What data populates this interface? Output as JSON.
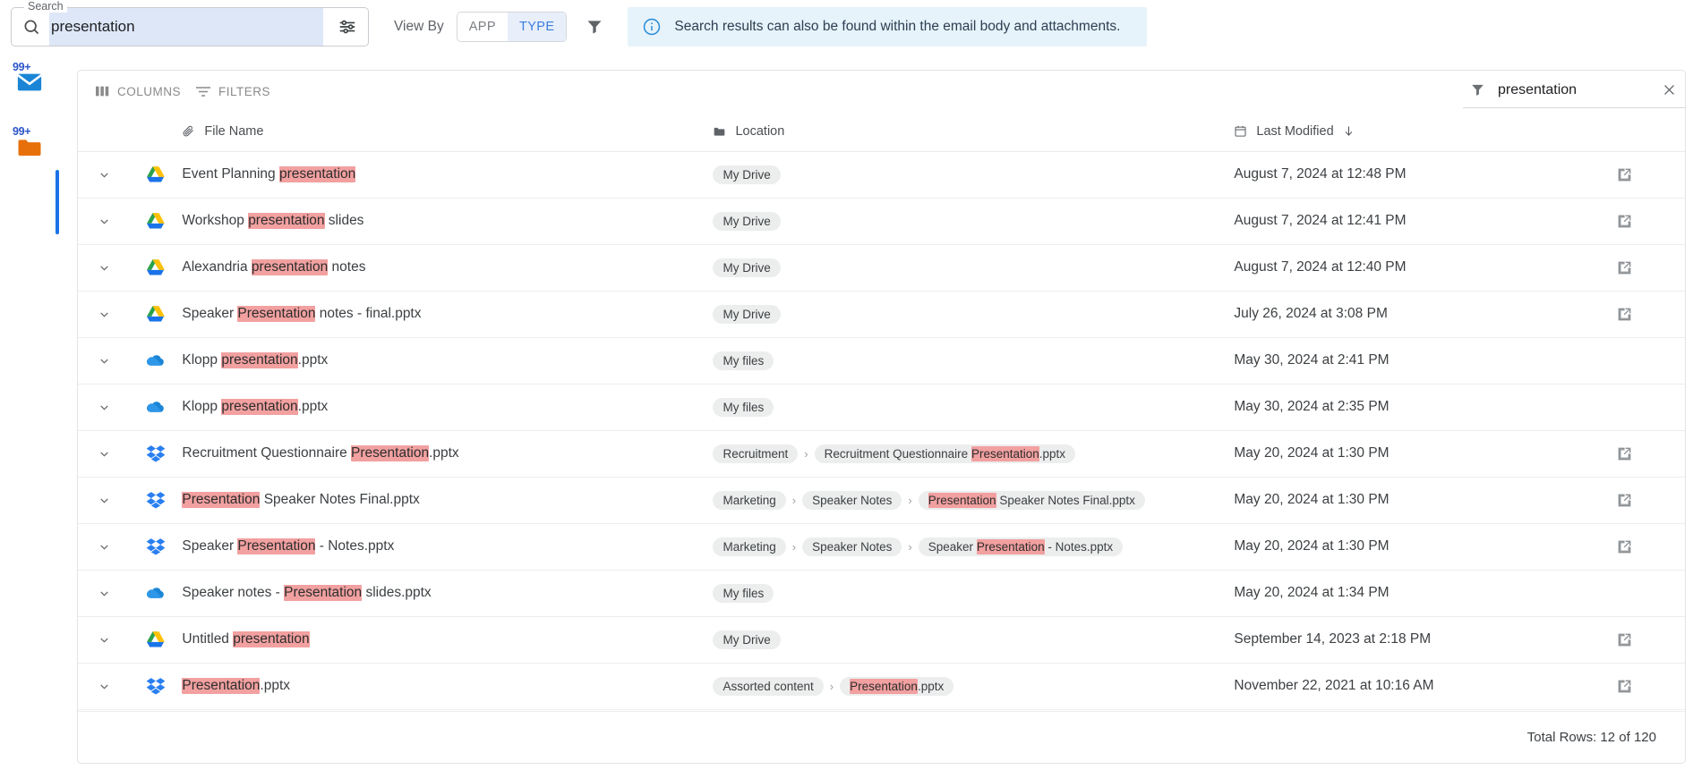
{
  "topbar": {
    "search": {
      "legend": "Search",
      "value": "presentation",
      "placeholder": "Search",
      "icon": "search-icon",
      "tune_icon": "tune-icon"
    },
    "view_by_label": "View By",
    "toggles": [
      {
        "label": "APP",
        "active": false
      },
      {
        "label": "TYPE",
        "active": true
      }
    ],
    "funnel_icon": "filter-funnel-icon",
    "info_banner": {
      "icon": "info-circle-icon",
      "text": "Search results can also be found within the email body and attachments.",
      "background": "#e6f3fb"
    }
  },
  "rail": {
    "items": [
      {
        "name": "mail",
        "badge": "99+",
        "color": "#1a85d6"
      },
      {
        "name": "folder",
        "badge": "99+",
        "color": "#e8700a"
      }
    ],
    "accent_color": "#1a73e8"
  },
  "panel": {
    "toolbar": {
      "columns_label": "COLUMNS",
      "columns_icon": "columns-icon",
      "filters_label": "FILTERS",
      "filters_icon": "filters-icon"
    },
    "filter_chip": {
      "icon": "funnel-icon",
      "value": "presentation",
      "close_icon": "close-icon"
    },
    "columns": [
      {
        "key": "file_name",
        "label": "File Name",
        "icon": "paperclip-icon"
      },
      {
        "key": "location",
        "label": "Location",
        "icon": "folder-icon"
      },
      {
        "key": "last_modified",
        "label": "Last Modified",
        "icon": "calendar-icon",
        "sort": "desc",
        "sort_icon": "arrow-down-icon"
      }
    ],
    "rows": [
      {
        "app": "google-drive",
        "name_parts": [
          {
            "t": "Event Planning ",
            "h": false
          },
          {
            "t": "presentation",
            "h": true
          }
        ],
        "location": [
          {
            "label": "My Drive",
            "parts": [
              {
                "t": "My Drive",
                "h": false
              }
            ]
          }
        ],
        "date": "August 7, 2024 at 12:48 PM",
        "open": true
      },
      {
        "app": "google-drive",
        "name_parts": [
          {
            "t": "Workshop ",
            "h": false
          },
          {
            "t": "presentation",
            "h": true
          },
          {
            "t": " slides",
            "h": false
          }
        ],
        "location": [
          {
            "label": "My Drive",
            "parts": [
              {
                "t": "My Drive",
                "h": false
              }
            ]
          }
        ],
        "date": "August 7, 2024 at 12:41 PM",
        "open": true
      },
      {
        "app": "google-drive",
        "name_parts": [
          {
            "t": "Alexandria ",
            "h": false
          },
          {
            "t": "presentation",
            "h": true
          },
          {
            "t": " notes",
            "h": false
          }
        ],
        "location": [
          {
            "label": "My Drive",
            "parts": [
              {
                "t": "My Drive",
                "h": false
              }
            ]
          }
        ],
        "date": "August 7, 2024 at 12:40 PM",
        "open": true
      },
      {
        "app": "google-drive",
        "name_parts": [
          {
            "t": "Speaker ",
            "h": false
          },
          {
            "t": "Presentation",
            "h": true
          },
          {
            "t": " notes - final.pptx",
            "h": false
          }
        ],
        "location": [
          {
            "label": "My Drive",
            "parts": [
              {
                "t": "My Drive",
                "h": false
              }
            ]
          }
        ],
        "date": "July 26, 2024 at 3:08 PM",
        "open": true
      },
      {
        "app": "onedrive",
        "name_parts": [
          {
            "t": "Klopp ",
            "h": false
          },
          {
            "t": "presentation",
            "h": true
          },
          {
            "t": ".pptx",
            "h": false
          }
        ],
        "location": [
          {
            "label": "My files",
            "parts": [
              {
                "t": "My files",
                "h": false
              }
            ]
          }
        ],
        "date": "May 30, 2024 at 2:41 PM",
        "open": false
      },
      {
        "app": "onedrive",
        "name_parts": [
          {
            "t": "Klopp ",
            "h": false
          },
          {
            "t": "presentation",
            "h": true
          },
          {
            "t": ".pptx",
            "h": false
          }
        ],
        "location": [
          {
            "label": "My files",
            "parts": [
              {
                "t": "My files",
                "h": false
              }
            ]
          }
        ],
        "date": "May 30, 2024 at 2:35 PM",
        "open": false
      },
      {
        "app": "dropbox",
        "name_parts": [
          {
            "t": "Recruitment Questionnaire ",
            "h": false
          },
          {
            "t": "Presentation",
            "h": true
          },
          {
            "t": ".pptx",
            "h": false
          }
        ],
        "location": [
          {
            "label": "Recruitment",
            "parts": [
              {
                "t": "Recruitment",
                "h": false
              }
            ]
          },
          {
            "label": "Recruitment Questionnaire Presentation.pptx",
            "parts": [
              {
                "t": "Recruitment Questionnaire ",
                "h": false
              },
              {
                "t": "Presentation",
                "h": true
              },
              {
                "t": ".pptx",
                "h": false
              }
            ]
          }
        ],
        "date": "May 20, 2024 at 1:30 PM",
        "open": true
      },
      {
        "app": "dropbox",
        "name_parts": [
          {
            "t": "Presentation",
            "h": true
          },
          {
            "t": " Speaker Notes Final.pptx",
            "h": false
          }
        ],
        "location": [
          {
            "label": "Marketing",
            "parts": [
              {
                "t": "Marketing",
                "h": false
              }
            ]
          },
          {
            "label": "Speaker Notes",
            "parts": [
              {
                "t": "Speaker Notes",
                "h": false
              }
            ]
          },
          {
            "label": "Presentation Speaker Notes Final.pptx",
            "parts": [
              {
                "t": "Presentation",
                "h": true
              },
              {
                "t": " Speaker Notes Final.pptx",
                "h": false
              }
            ]
          }
        ],
        "date": "May 20, 2024 at 1:30 PM",
        "open": true
      },
      {
        "app": "dropbox",
        "name_parts": [
          {
            "t": "Speaker ",
            "h": false
          },
          {
            "t": "Presentation",
            "h": true
          },
          {
            "t": " - Notes.pptx",
            "h": false
          }
        ],
        "location": [
          {
            "label": "Marketing",
            "parts": [
              {
                "t": "Marketing",
                "h": false
              }
            ]
          },
          {
            "label": "Speaker Notes",
            "parts": [
              {
                "t": "Speaker Notes",
                "h": false
              }
            ]
          },
          {
            "label": "Speaker Presentation - Notes.pptx",
            "parts": [
              {
                "t": "Speaker ",
                "h": false
              },
              {
                "t": "Presentation",
                "h": true
              },
              {
                "t": " - Notes.pptx",
                "h": false
              }
            ]
          }
        ],
        "date": "May 20, 2024 at 1:30 PM",
        "open": true
      },
      {
        "app": "onedrive",
        "name_parts": [
          {
            "t": "Speaker notes - ",
            "h": false
          },
          {
            "t": "Presentation",
            "h": true
          },
          {
            "t": " slides.pptx",
            "h": false
          }
        ],
        "location": [
          {
            "label": "My files",
            "parts": [
              {
                "t": "My files",
                "h": false
              }
            ]
          }
        ],
        "date": "May 20, 2024 at 1:34 PM",
        "open": false
      },
      {
        "app": "google-drive",
        "name_parts": [
          {
            "t": "Untitled ",
            "h": false
          },
          {
            "t": "presentation",
            "h": true
          }
        ],
        "location": [
          {
            "label": "My Drive",
            "parts": [
              {
                "t": "My Drive",
                "h": false
              }
            ]
          }
        ],
        "date": "September 14, 2023 at 2:18 PM",
        "open": true
      },
      {
        "app": "dropbox",
        "name_parts": [
          {
            "t": "Presentation",
            "h": true
          },
          {
            "t": ".pptx",
            "h": false
          }
        ],
        "location": [
          {
            "label": "Assorted content",
            "parts": [
              {
                "t": "Assorted content",
                "h": false
              }
            ]
          },
          {
            "label": "Presentation.pptx",
            "parts": [
              {
                "t": "Presentation",
                "h": true
              },
              {
                "t": ".pptx",
                "h": false
              }
            ]
          }
        ],
        "date": "November 22, 2021 at 10:16 AM",
        "open": true
      }
    ],
    "footer": {
      "total_rows_text": "Total Rows: 12 of 120"
    }
  },
  "colors": {
    "highlight": "#f2a0a0",
    "accent_blue": "#1a73e8",
    "info_bg": "#e6f3fb",
    "chip_bg": "#eceded"
  }
}
